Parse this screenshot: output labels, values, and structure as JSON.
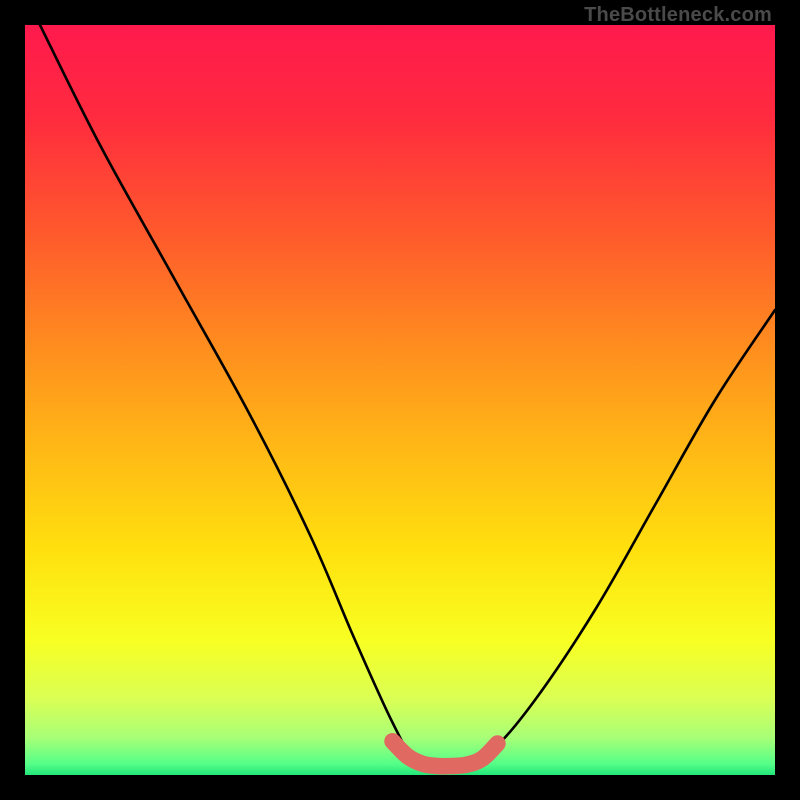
{
  "watermark": "TheBottleneck.com",
  "gradient_stops": [
    {
      "offset": 0.0,
      "color": "#ff1a4d"
    },
    {
      "offset": 0.12,
      "color": "#ff2a3f"
    },
    {
      "offset": 0.28,
      "color": "#ff5a2c"
    },
    {
      "offset": 0.42,
      "color": "#ff8a1f"
    },
    {
      "offset": 0.56,
      "color": "#ffb716"
    },
    {
      "offset": 0.7,
      "color": "#ffe00e"
    },
    {
      "offset": 0.82,
      "color": "#f8ff22"
    },
    {
      "offset": 0.9,
      "color": "#d9ff55"
    },
    {
      "offset": 0.95,
      "color": "#a8ff77"
    },
    {
      "offset": 0.985,
      "color": "#55ff88"
    },
    {
      "offset": 1.0,
      "color": "#22e57a"
    }
  ],
  "chart_data": {
    "type": "line",
    "title": "",
    "xlabel": "",
    "ylabel": "",
    "xlim": [
      0,
      100
    ],
    "ylim": [
      0,
      100
    ],
    "grid": false,
    "series": [
      {
        "name": "bottleneck-curve",
        "color": "#000000",
        "x": [
          2,
          10,
          20,
          30,
          38,
          44,
          49,
          52,
          55,
          58,
          62,
          68,
          76,
          84,
          92,
          100
        ],
        "y": [
          100,
          84,
          66,
          48,
          32,
          18,
          7,
          2,
          1,
          1,
          3,
          10,
          22,
          36,
          50,
          62
        ]
      },
      {
        "name": "optimal-band",
        "color": "#e06a62",
        "x": [
          49,
          51,
          53,
          55,
          57,
          59,
          61,
          63
        ],
        "y": [
          4.5,
          2.5,
          1.5,
          1.2,
          1.2,
          1.4,
          2.2,
          4.2
        ]
      }
    ],
    "annotations": []
  }
}
